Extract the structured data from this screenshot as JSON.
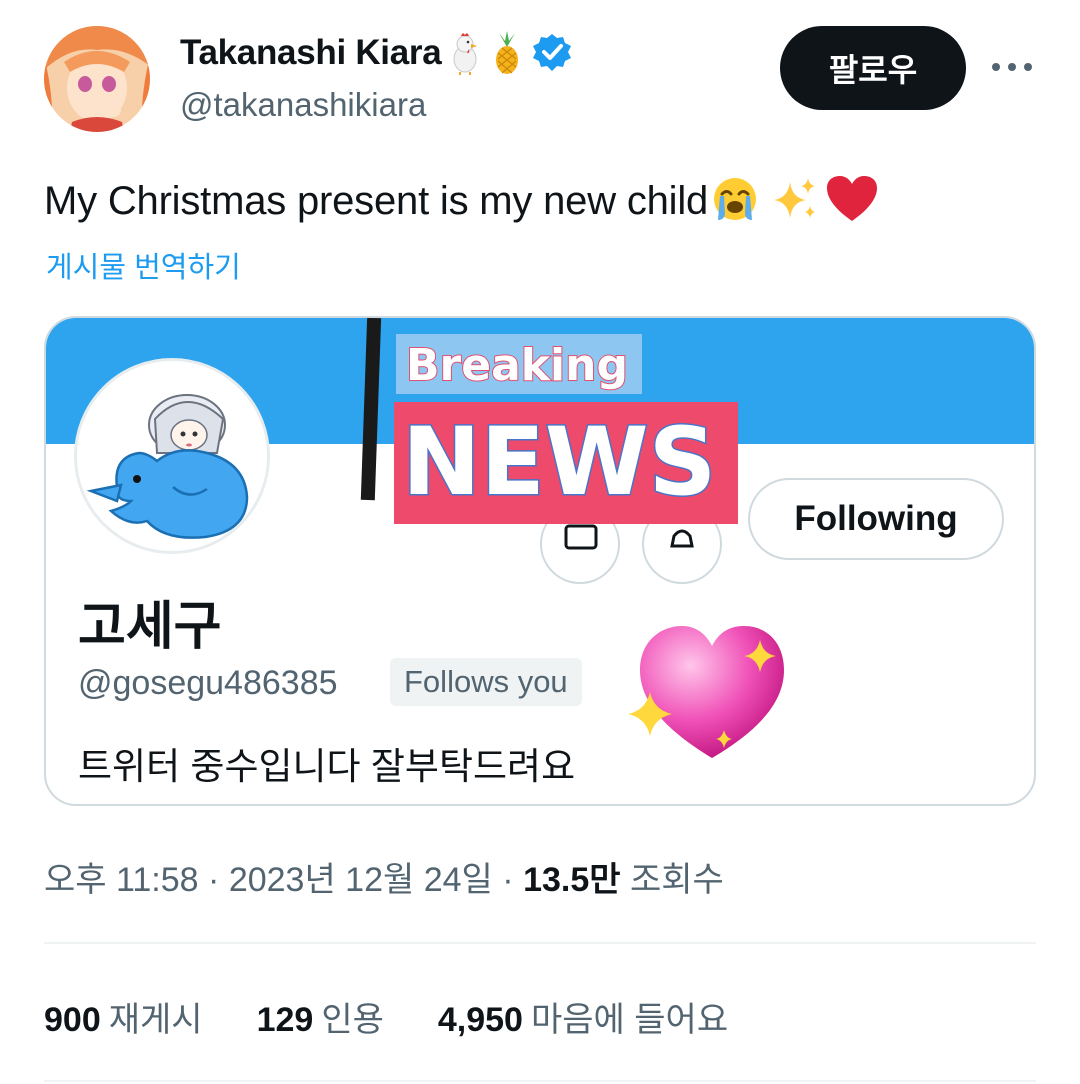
{
  "author": {
    "display_name": "Takanashi Kiara",
    "handle": "@takanashikiara",
    "name_emojis": [
      "chicken-emoji",
      "pineapple-emoji",
      "verified-badge-icon"
    ]
  },
  "follow_button": {
    "label": "팔로우"
  },
  "tweet": {
    "text": "My Christmas present is my new child",
    "trailing_emojis": [
      "crying-face-emoji",
      "sparkles-emoji",
      "red-heart-emoji"
    ],
    "translate_label": "게시물 번역하기"
  },
  "media": {
    "profile_name": "고세구",
    "profile_handle": "@gosegu486385",
    "follows_you": "Follows you",
    "bio": "트위터 중수입니다 잘부탁드려요",
    "following_label": "Following",
    "overlay_top": "Breaking",
    "overlay_bottom": "NEWS"
  },
  "meta": {
    "time": "오후 11:58",
    "separator": "·",
    "date": "2023년 12월 24일",
    "views_count": "13.5만",
    "views_label": "조회수"
  },
  "stats": [
    {
      "count": "900",
      "label": "재게시"
    },
    {
      "count": "129",
      "label": "인용"
    },
    {
      "count": "4,950",
      "label": "마음에 들어요"
    }
  ],
  "colors": {
    "link": "#1d9bf0",
    "banner": "#2ea3ee",
    "news_red": "#ef4a6e",
    "text_secondary": "#536471"
  }
}
